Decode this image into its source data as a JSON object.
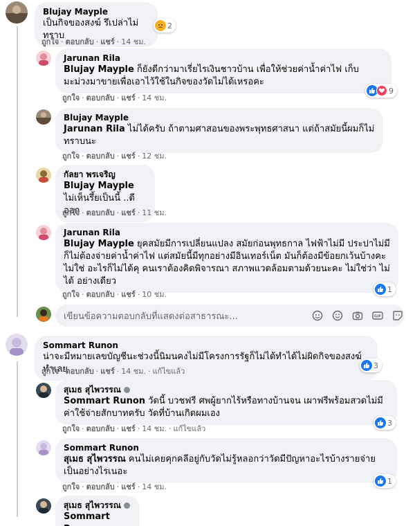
{
  "comments": [
    {
      "author": "Blujay Mayple",
      "text": "เป็นกิจของสงฆ์ รึเปล่าไม่ทราบ",
      "reaction_count": "2",
      "actions": {
        "like": "ถูกใจ",
        "reply": "ตอบกลับ",
        "share": "แชร์",
        "time": "14 ชม."
      }
    },
    {
      "author": "Jarunan Rila",
      "tag": "Blujay Mayple",
      "text": " ก็ยังดีกว่ามาเรี่ยไรเงินชาวบ้าน เพื่อให้ช่วยค่าน้ำค่าไฟ เก็บมะม่วงมาขายเพื่อเอาไว้ใช้ในกิจของวัดไม่ได้เหรอคะ",
      "reaction_count": "9",
      "actions": {
        "like": "ถูกใจ",
        "reply": "ตอบกลับ",
        "share": "แชร์",
        "time": "14 ชม."
      }
    },
    {
      "author": "Blujay Mayple",
      "tag": "Jarunan Rila",
      "text": " ไม่ได้ครับ ถ้าตามศาสอนของพระพุทธศาสนา แต่ถ้าสมัยนี้ผมก็ไม่ทราบนะ",
      "actions": {
        "like": "ถูกใจ",
        "reply": "ตอบกลับ",
        "share": "แชร์",
        "time": "12 ชม."
      }
    },
    {
      "author": "กัลยา พรเจริญ",
      "tag": "Blujay Mayple",
      "text": "ไม่เห็นรึ้ยเป็นนี้ ..ดีออก",
      "actions": {
        "like": "ถูกใจ",
        "reply": "ตอบกลับ",
        "share": "แชร์",
        "time": "11 ชม."
      }
    },
    {
      "author": "Jarunan Rila",
      "tag": "Blujay Mayple",
      "text": " ยุคสมัยมีการเปลี่ยนแปลง สมัยก่อนพุทธกาล ไฟฟ้าไม่มี ประปาไม่มี ก็ไม่ต้องจ่ายค่าน้ำค่าไฟ แต่สมัยนี้มีทุกอย่างมีอินเทอร์เน็ต มันก็ต้องมีข้อยกเว้นบ้างคะ ไม่ใช่ อะไรก็ไม่ได้คุ คนเราต้องคิดพิจารณา สภาพแวดล้อมตามด้วยนะคะ ไม่ใช่ว่า ไม่ได้ อย่างเดียว",
      "reaction_count": "1",
      "actions": {
        "like": "ถูกใจ",
        "reply": "ตอบกลับ",
        "share": "แชร์",
        "time": "10 ชม."
      }
    },
    {
      "author": "Sommart Runon",
      "text": "น่าจะมีหมายเลขบัญชีนะช่วงนี้นิมนคงไม่มีโครงการรัฐก็ไม่ได้ทำได้ไม่ผิดกิจของสงฆ์ทำเลย",
      "reaction_count": "3",
      "actions": {
        "like": "ถูกใจ",
        "reply": "ตอบกลับ",
        "share": "แชร์",
        "time": "14 ชม.",
        "edited": "แก้ไขแล้ว"
      }
    },
    {
      "author": "สุเมธ สุไพวรรณ",
      "tag": "Sommart Runon",
      "text": " วัดนี้ บวชฟรี ศพผู้ยากไร้หรือทางบ้านจน เผาฟรีพร้อมสวดไม่มีค่าใช้จ่ายสักบาทครับ วัดที่บ้านเกิดผมเอง",
      "reaction_count": "3",
      "actions": {
        "like": "ถูกใจ",
        "reply": "ตอบกลับ",
        "share": "แชร์",
        "time": "14 ชม.",
        "edited": "แก้ไขแล้ว"
      }
    },
    {
      "author": "Sommart Runon",
      "tag": "สุเมธ สุไพวรรณ",
      "text": " คนไม่เคยคุกคลีอยู่กับวัดไม่รู้หลอกว่าวัดมีปัญหาอะไรบ้างรายจ่ายเป็นอย่างไรเนอะ",
      "reaction_count": "1",
      "actions": {
        "like": "ถูกใจ",
        "reply": "ตอบกลับ",
        "share": "แชร์",
        "time": "14 ชม."
      }
    },
    {
      "author": "สุเมธ สุไพวรรณ",
      "tag": "Sommart Runon"
    }
  ],
  "reply_input": {
    "placeholder": "เขียนข้อความตอบกลับที่แสดงต่อสาธารณะ..."
  },
  "icons": {
    "reaction_like": "like-icon",
    "reaction_love": "love-icon",
    "reaction_sad": "sad-icon",
    "input": [
      "sticker-icon",
      "emoji-icon",
      "camera-icon",
      "gif-icon",
      "sticker-face-icon"
    ]
  },
  "colors": {
    "bubble": "#f0f2f5",
    "like": "#1877f2",
    "love": "#f33e58",
    "sad": "#f7b125",
    "muted_text": "#65676b"
  }
}
